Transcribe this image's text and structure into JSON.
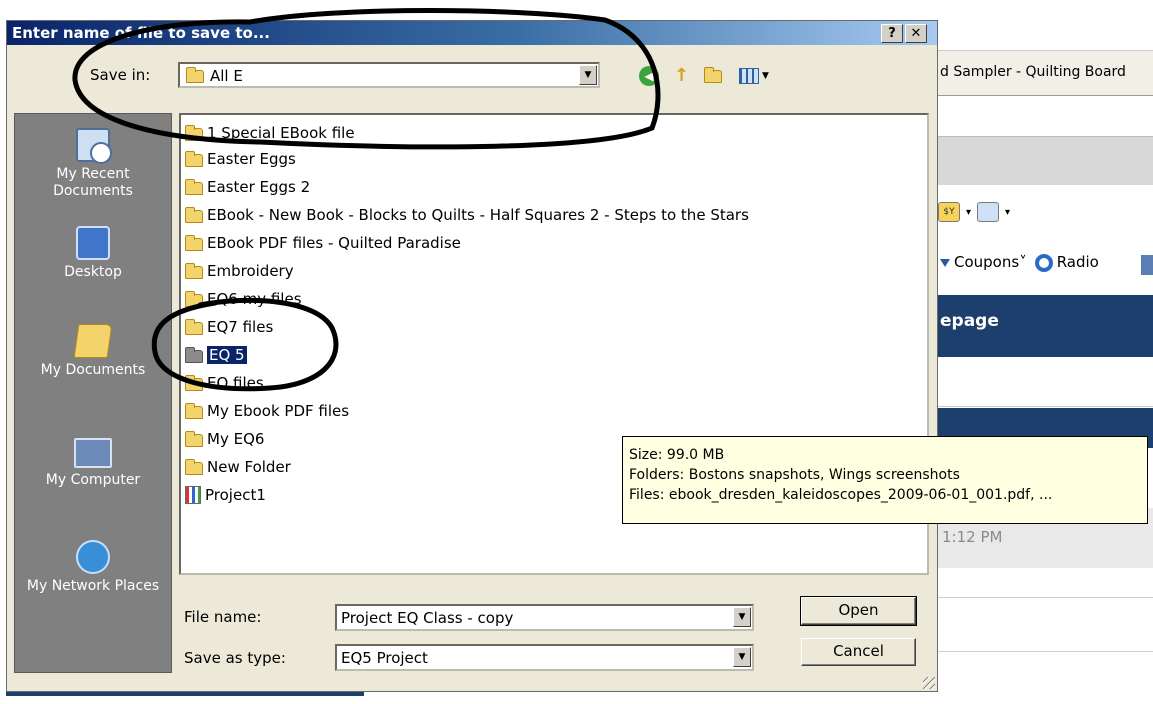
{
  "dialog": {
    "title": "Enter name of file to save to...",
    "help_label": "?",
    "close_label": "✕"
  },
  "save_in": {
    "label": "Save in:",
    "value": "All E"
  },
  "toolbar": {
    "back_icon": "back-arrow-icon",
    "up_icon": "up-folder-icon",
    "new_folder_icon": "new-folder-icon",
    "views_icon": "views-menu-icon"
  },
  "places": {
    "recent": "My Recent Documents",
    "desktop": "Desktop",
    "my_documents": "My Documents",
    "my_computer": "My Computer",
    "network": "My Network Places"
  },
  "files": [
    {
      "label": "1 Special EBook file",
      "type": "folder"
    },
    {
      "label": "Easter Eggs",
      "type": "folder"
    },
    {
      "label": "Easter Eggs 2",
      "type": "folder"
    },
    {
      "label": "EBook - New Book - Blocks to Quilts - Half Squares 2 - Steps to the Stars",
      "type": "folder"
    },
    {
      "label": "EBook PDF files - Quilted Paradise",
      "type": "folder"
    },
    {
      "label": "Embroidery",
      "type": "folder"
    },
    {
      "label": "EQ6 my files",
      "type": "folder"
    },
    {
      "label": "EQ7 files",
      "type": "folder"
    },
    {
      "label": "EQ 5",
      "type": "folder",
      "selected": true
    },
    {
      "label": "EQ files",
      "type": "folder"
    },
    {
      "label": "My Ebook PDF files",
      "type": "folder"
    },
    {
      "label": "My EQ6",
      "type": "folder"
    },
    {
      "label": "New Folder",
      "type": "folder"
    },
    {
      "label": "Project1",
      "type": "project"
    }
  ],
  "tooltip": {
    "size": "Size: 99.0 MB",
    "folders": "Folders: Bostons snapshots, Wings screenshots",
    "files": "Files: ebook_dresden_kaleidoscopes_2009-06-01_001.pdf, ..."
  },
  "file_name": {
    "label": "File name:",
    "value": "Project EQ Class - copy"
  },
  "file_type": {
    "label": "Save as type:",
    "value": "EQ5 Project"
  },
  "buttons": {
    "open": "Open",
    "cancel": "Cancel"
  },
  "background_window": {
    "tab_title": "d Sampler - Quilting Board",
    "coupons": "Coupons",
    "radio": "Radio",
    "page_heading": "epage",
    "time": "1:12 PM"
  },
  "colors": {
    "title_bar": "#0a246a",
    "selection": "#0a246a",
    "places_bar": "#808080",
    "tooltip_bg": "#ffffe1",
    "page_header_blue": "#1c3f6e"
  }
}
